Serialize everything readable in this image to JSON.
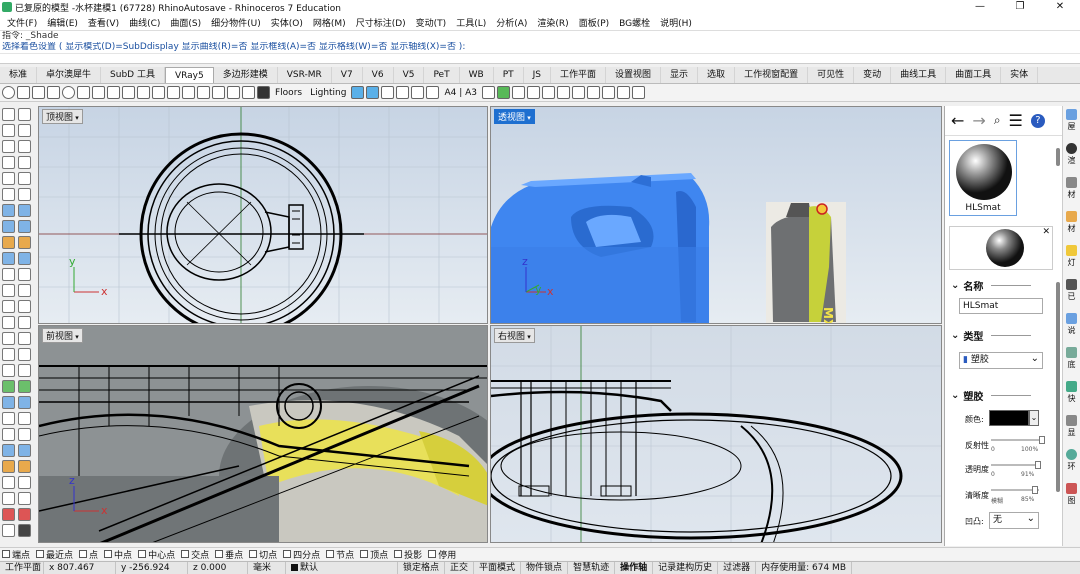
{
  "window": {
    "title": "已复原的模型 -水杯建模1 (67728) RhinoAutosave - Rhinoceros 7 Education",
    "controls": [
      "—",
      "❐",
      "✕"
    ]
  },
  "menu": [
    "文件(F)",
    "编辑(E)",
    "查看(V)",
    "曲线(C)",
    "曲面(S)",
    "细分物件(U)",
    "实体(O)",
    "网格(M)",
    "尺寸标注(D)",
    "变动(T)",
    "工具(L)",
    "分析(A)",
    "渲染(R)",
    "面板(P)",
    "BG螺栓",
    "说明(H)"
  ],
  "command": {
    "history": "指令: _Shade",
    "prompt_label": "选择着色设置",
    "prompt_options": "( 显示模式(D)=SubDdisplay  显示曲线(R)=否  显示框线(A)=否  显示格线(W)=否  显示轴线(X)=否 ):"
  },
  "tabs": [
    {
      "label": "标准",
      "active": false
    },
    {
      "label": "卓尔澳犀牛",
      "active": false
    },
    {
      "label": "SubD 工具",
      "active": false
    },
    {
      "label": "VRay5",
      "active": true
    },
    {
      "label": "多边形建模",
      "active": false
    },
    {
      "label": "VSR-MR",
      "active": false
    },
    {
      "label": "V7",
      "active": false
    },
    {
      "label": "V6",
      "active": false
    },
    {
      "label": "V5",
      "active": false
    },
    {
      "label": "PeT",
      "active": false
    },
    {
      "label": "WB",
      "active": false
    },
    {
      "label": "PT",
      "active": false
    },
    {
      "label": "JS",
      "active": false
    },
    {
      "label": "工作平面",
      "active": false
    },
    {
      "label": "设置视图",
      "active": false
    },
    {
      "label": "显示",
      "active": false
    },
    {
      "label": "选取",
      "active": false
    },
    {
      "label": "工作视窗配置",
      "active": false
    },
    {
      "label": "可见性",
      "active": false
    },
    {
      "label": "变动",
      "active": false
    },
    {
      "label": "曲线工具",
      "active": false
    },
    {
      "label": "曲面工具",
      "active": false
    },
    {
      "label": "实体",
      "active": false
    }
  ],
  "toolbar": {
    "floors_label": "Floors",
    "lighting_label": "Lighting",
    "paper_label": "A4 | A3"
  },
  "viewports": {
    "top": {
      "label": "顶视图",
      "active": false
    },
    "perspective": {
      "label": "透视图",
      "active": true
    },
    "front": {
      "label": "前视图",
      "active": false
    },
    "right": {
      "label": "右视图",
      "active": false
    },
    "axis_x": "x",
    "axis_y": "y",
    "axis_z": "z",
    "product_text": "MXO"
  },
  "material_panel": {
    "material_name": "HLSmat",
    "name_section": "名称",
    "name_value": "HLSmat",
    "type_section": "类型",
    "type_value": "塑胶",
    "plastic_section": "塑胶",
    "color_label": "颜色:",
    "reflect_label": "反射性",
    "reflect_min": "0",
    "reflect_max": "100%",
    "reflect_value": 1.0,
    "transparency_label": "透明度",
    "transparency_min": "0",
    "transparency_max": "91%",
    "transparency_value": 0.91,
    "clarity_label": "清晰度",
    "clarity_min": "模糊",
    "clarity_max": "85%",
    "clarity_value": 0.85,
    "bump_label": "凹凸:",
    "bump_value": "无",
    "color_hex": "#000000"
  },
  "side_tabs": [
    "屋",
    "渲",
    "材",
    "材",
    "灯",
    "已",
    "说",
    "底",
    "快",
    "显",
    "环",
    "图"
  ],
  "osnaps": [
    "端点",
    "最近点",
    "点",
    "中点",
    "中心点",
    "交点",
    "垂点",
    "切点",
    "四分点",
    "节点",
    "顶点",
    "投影",
    "停用"
  ],
  "status": {
    "cplane": "工作平面",
    "x": "x 807.467",
    "y": "y -256.924",
    "z": "z 0.000",
    "units": "毫米",
    "layer": "默认",
    "grid_snap": "锁定格点",
    "ortho": "正交",
    "planar": "平面模式",
    "osnap": "物件锁点",
    "smarttrack": "智慧轨迹",
    "gumball": "操作轴",
    "history": "记录建构历史",
    "filter": "过滤器",
    "memory": "内存使用量: 674 MB"
  }
}
